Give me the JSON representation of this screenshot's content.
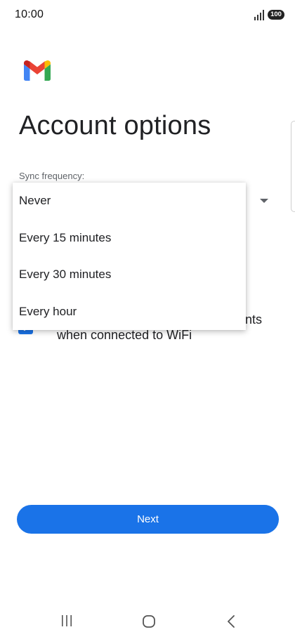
{
  "status_bar": {
    "time": "10:00",
    "battery": "100",
    "icons": [
      "signal-icon",
      "battery-icon"
    ]
  },
  "app": {
    "logo": "gmail-logo",
    "brand_colors": [
      "#4285F4",
      "#EA4335",
      "#FBBC04",
      "#34A853",
      "#C5221F"
    ]
  },
  "page": {
    "title": "Account options"
  },
  "sync": {
    "label": "Sync frequency:",
    "dropdown_icon": "arrow-drop-down-icon",
    "options": [
      "Never",
      "Every 15 minutes",
      "Every 30 minutes",
      "Every hour"
    ]
  },
  "download_option": {
    "checked": true,
    "label_line1": "nts",
    "label_line2": "when connected to WiFi"
  },
  "actions": {
    "next_label": "Next"
  },
  "nav_bar": {
    "icons": [
      "recents-icon",
      "home-icon",
      "back-icon"
    ]
  },
  "colors": {
    "accent": "#1a73e8",
    "text_primary": "#202124",
    "text_secondary": "#5f6368"
  }
}
